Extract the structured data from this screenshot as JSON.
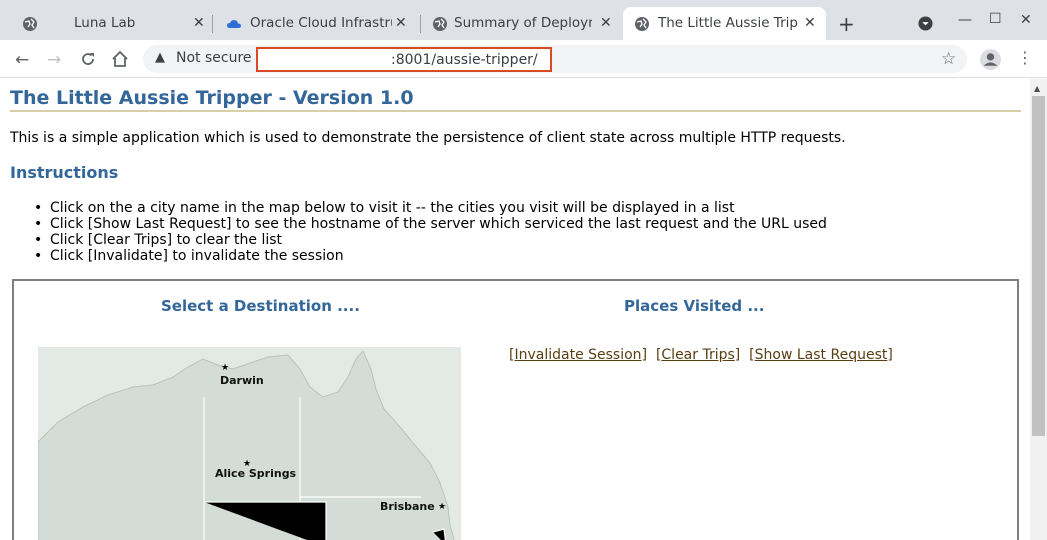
{
  "browser": {
    "tabs": [
      {
        "title": "Luna Lab"
      },
      {
        "title": "Oracle Cloud Infrastru"
      },
      {
        "title": "Summary of Deploym"
      },
      {
        "title": "The Little Aussie Tripp"
      }
    ],
    "new_tab_label": "+",
    "security_label": "Not secure",
    "url": ":8001/aussie-tripper/"
  },
  "page": {
    "title": "The Little Aussie Tripper - Version 1.0",
    "intro": "This is a simple application which is used to demonstrate the persistence of client state across multiple HTTP requests.",
    "instructions_heading": "Instructions",
    "instructions": [
      "Click on the a city name in the map below to visit it -- the cities you visit will be displayed in a list",
      "Click [Show Last Request] to see the hostname of the server which serviced the last request and the URL used",
      "Click [Clear Trips] to clear the list",
      "Click [Invalidate] to invalidate the session"
    ],
    "select_heading": "Select a Destination ....",
    "visited_heading": "Places Visited ...",
    "links": {
      "invalidate": "Invalidate Session",
      "clear": "Clear Trips",
      "show_last": "Show Last Request"
    },
    "cities": {
      "darwin": "Darwin",
      "alice": "Alice Springs",
      "brisbane": "Brisbane"
    }
  },
  "colors": {
    "heading": "#336699",
    "link": "#5a3e12",
    "highlight": "#d94b25"
  }
}
